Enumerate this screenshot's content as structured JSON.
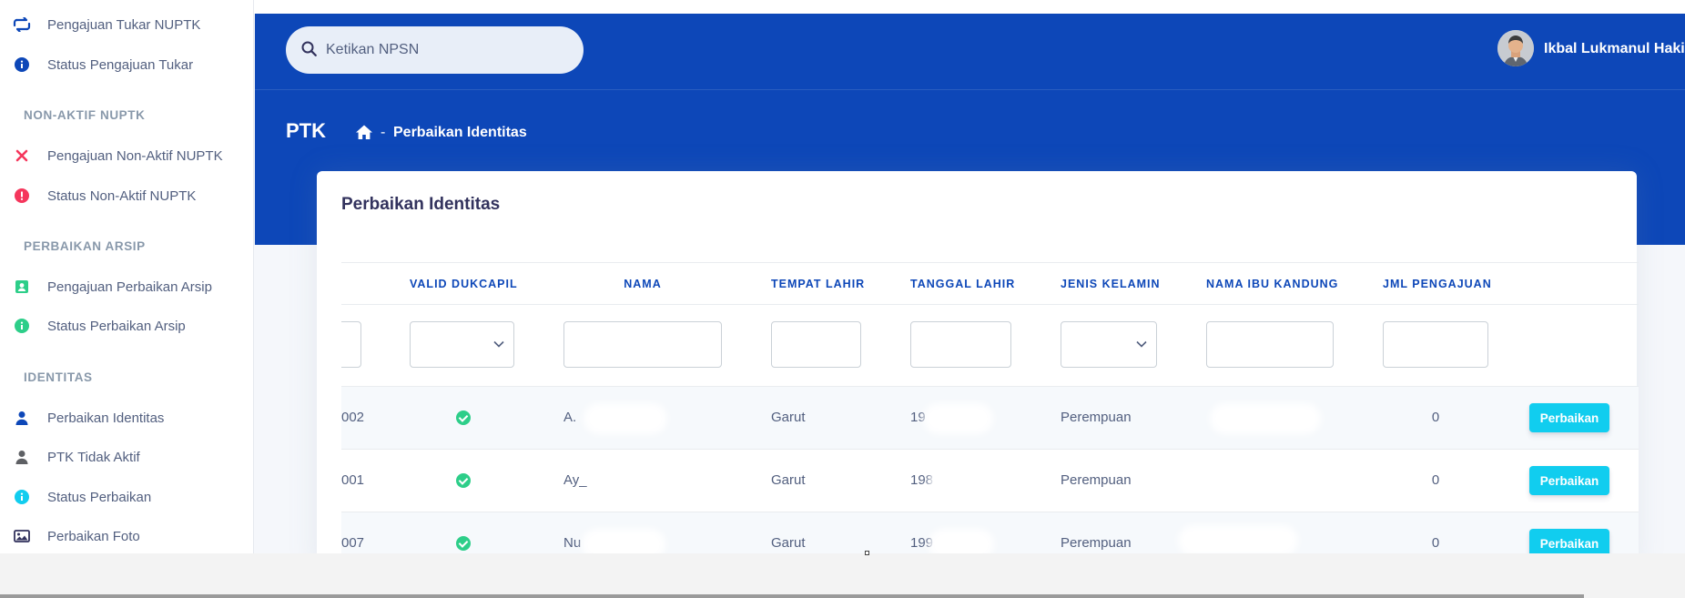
{
  "sidebar": {
    "items": [
      {
        "label": "Pengajuan Tukar NUPTK",
        "icon": "swap-icon"
      },
      {
        "label": "Status Pengajuan Tukar",
        "icon": "info-icon"
      },
      {
        "heading": "NON-AKTIF NUPTK"
      },
      {
        "label": "Pengajuan Non-Aktif NUPTK",
        "icon": "close-icon"
      },
      {
        "label": "Status Non-Aktif NUPTK",
        "icon": "alert-icon"
      },
      {
        "heading": "PERBAIKAN ARSIP"
      },
      {
        "label": "Pengajuan Perbaikan Arsip",
        "icon": "contact-card-icon"
      },
      {
        "label": "Status Perbaikan Arsip",
        "icon": "info-icon"
      },
      {
        "heading": "IDENTITAS"
      },
      {
        "label": "Perbaikan Identitas",
        "icon": "user-icon"
      },
      {
        "label": "PTK Tidak Aktif",
        "icon": "user-icon"
      },
      {
        "label": "Status Perbaikan",
        "icon": "info-icon"
      },
      {
        "label": "Perbaikan Foto",
        "icon": "image-icon"
      }
    ]
  },
  "header": {
    "search_placeholder": "Ketikan NPSN",
    "user_name": "Ikbal Lukmanul Hakim",
    "page_title": "PTK",
    "breadcrumb_separator": "-",
    "breadcrumb_current": "Perbaikan Identitas"
  },
  "card": {
    "title": "Perbaikan Identitas"
  },
  "table": {
    "columns": [
      "VALID DUKCAPIL",
      "NAMA",
      "TEMPAT LAHIR",
      "TANGGAL LAHIR",
      "JENIS KELAMIN",
      "NAMA IBU KANDUNG",
      "JML PENGAJUAN"
    ],
    "rows": [
      {
        "id_fragment": "002",
        "nama": "A.",
        "tempat_lahir": "Garut",
        "tanggal_lahir": "19",
        "jenis_kelamin": "Perempuan",
        "jml_pengajuan": "0",
        "action": "Perbaikan"
      },
      {
        "id_fragment": "001",
        "nama": "Ay_",
        "tempat_lahir": "Garut",
        "tanggal_lahir": "198",
        "jenis_kelamin": "Perempuan",
        "jml_pengajuan": "0",
        "action": "Perbaikan"
      },
      {
        "id_fragment": "007",
        "nama": "Nu",
        "tempat_lahir": "Garut",
        "tanggal_lahir": "199",
        "jenis_kelamin": "Perempuan",
        "jml_pengajuan": "0",
        "action": "Perbaikan"
      }
    ]
  },
  "colors": {
    "primary": "#0d47b8",
    "info": "#11cdef",
    "success": "#2dce89",
    "danger": "#f5365c"
  }
}
